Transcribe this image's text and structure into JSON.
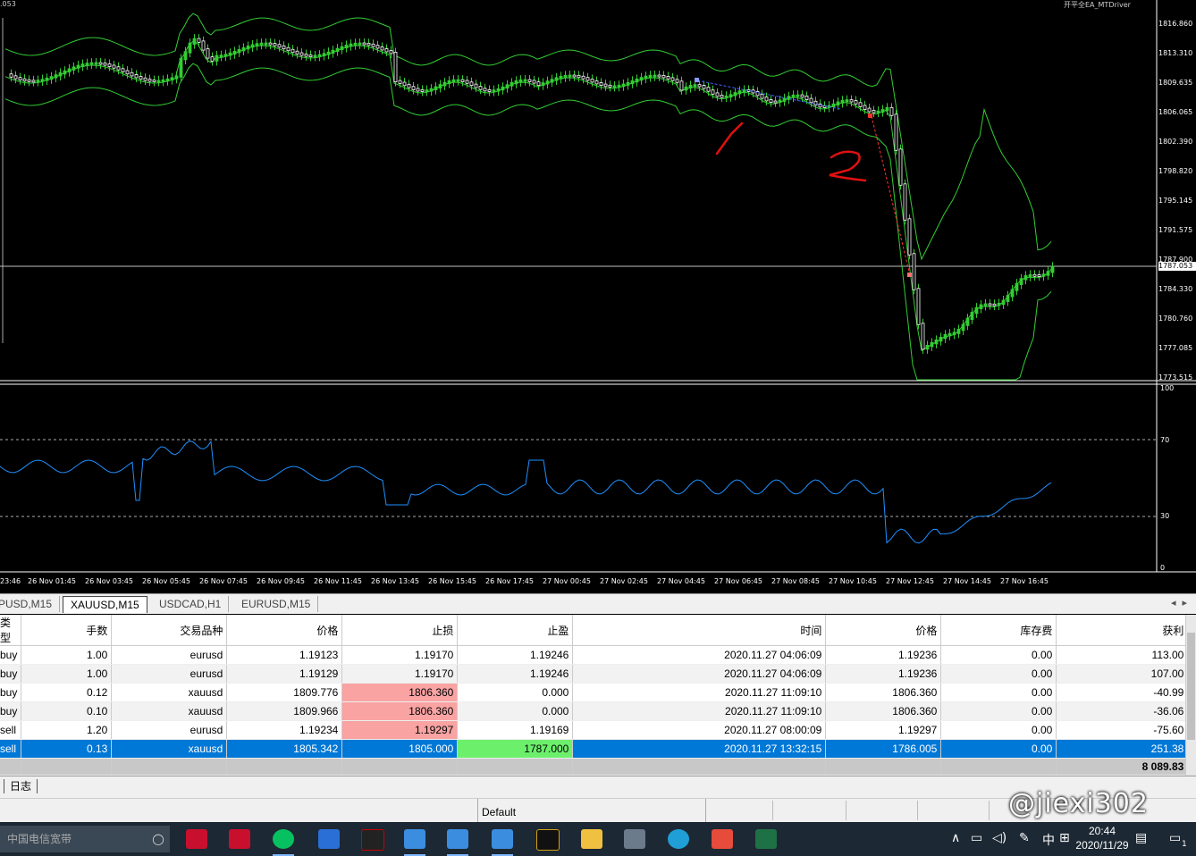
{
  "chart": {
    "corner_left": ".053",
    "corner_right": "开平全EA_MTDriver",
    "price_scale": [
      "1816.860",
      "1813.310",
      "1809.635",
      "1806.065",
      "1802.390",
      "1798.820",
      "1795.145",
      "1791.575",
      "1787.900",
      "1784.330",
      "1780.760",
      "1777.085",
      "1773.515"
    ],
    "current_price": "1787.053",
    "indicator_scale": [
      "100",
      "70",
      "30",
      "0"
    ],
    "time_axis": [
      "23:46",
      "26 Nov 01:45",
      "26 Nov 03:45",
      "26 Nov 05:45",
      "26 Nov 07:45",
      "26 Nov 09:45",
      "26 Nov 11:45",
      "26 Nov 13:45",
      "26 Nov 15:45",
      "26 Nov 17:45",
      "27 Nov 00:45",
      "27 Nov 02:45",
      "27 Nov 04:45",
      "27 Nov 06:45",
      "27 Nov 08:45",
      "27 Nov 10:45",
      "27 Nov 12:45",
      "27 Nov 14:45",
      "27 Nov 16:45"
    ],
    "annotations": [
      "1",
      "2"
    ],
    "colors": {
      "bull": "#32cd32",
      "bear": "#ffffff",
      "band": "#32cd32",
      "rsi": "#1e90ff",
      "current_line": "#c0c0c0"
    }
  },
  "chart_tabs": [
    "PUSD,M15",
    "XAUUSD,M15",
    "USDCAD,H1",
    "EURUSD,M15"
  ],
  "active_chart_tab": 1,
  "trade_table": {
    "headers": [
      "类型",
      "手数",
      "交易品种",
      "价格",
      "止损",
      "止盈",
      "时间",
      "价格",
      "库存费",
      "获利"
    ],
    "rows": [
      [
        "buy",
        "1.00",
        "eurusd",
        "1.19123",
        "1.19170",
        "1.19246",
        "2020.11.27 04:06:09",
        "1.19236",
        "0.00",
        "113.00"
      ],
      [
        "buy",
        "1.00",
        "eurusd",
        "1.19129",
        "1.19170",
        "1.19246",
        "2020.11.27 04:06:09",
        "1.19236",
        "0.00",
        "107.00"
      ],
      [
        "buy",
        "0.12",
        "xauusd",
        "1809.776",
        "1806.360",
        "0.000",
        "2020.11.27 11:09:10",
        "1806.360",
        "0.00",
        "-40.99"
      ],
      [
        "buy",
        "0.10",
        "xauusd",
        "1809.966",
        "1806.360",
        "0.000",
        "2020.11.27 11:09:10",
        "1806.360",
        "0.00",
        "-36.06"
      ],
      [
        "sell",
        "1.20",
        "eurusd",
        "1.19234",
        "1.19297",
        "1.19169",
        "2020.11.27 08:00:09",
        "1.19297",
        "0.00",
        "-75.60"
      ],
      [
        "sell",
        "0.13",
        "xauusd",
        "1805.342",
        "1805.000",
        "1787.000",
        "2020.11.27 13:32:15",
        "1786.005",
        "0.00",
        "251.38"
      ]
    ],
    "total": "8 089.83"
  },
  "bottom_tab": "日志",
  "statusbar": {
    "profile": "Default"
  },
  "watermark": "@jiexi302",
  "taskbar": {
    "search_placeholder": "中国电信宽带",
    "time": "20:44",
    "date": "2020/11/29",
    "ime": "中",
    "notification_count": "1"
  }
}
